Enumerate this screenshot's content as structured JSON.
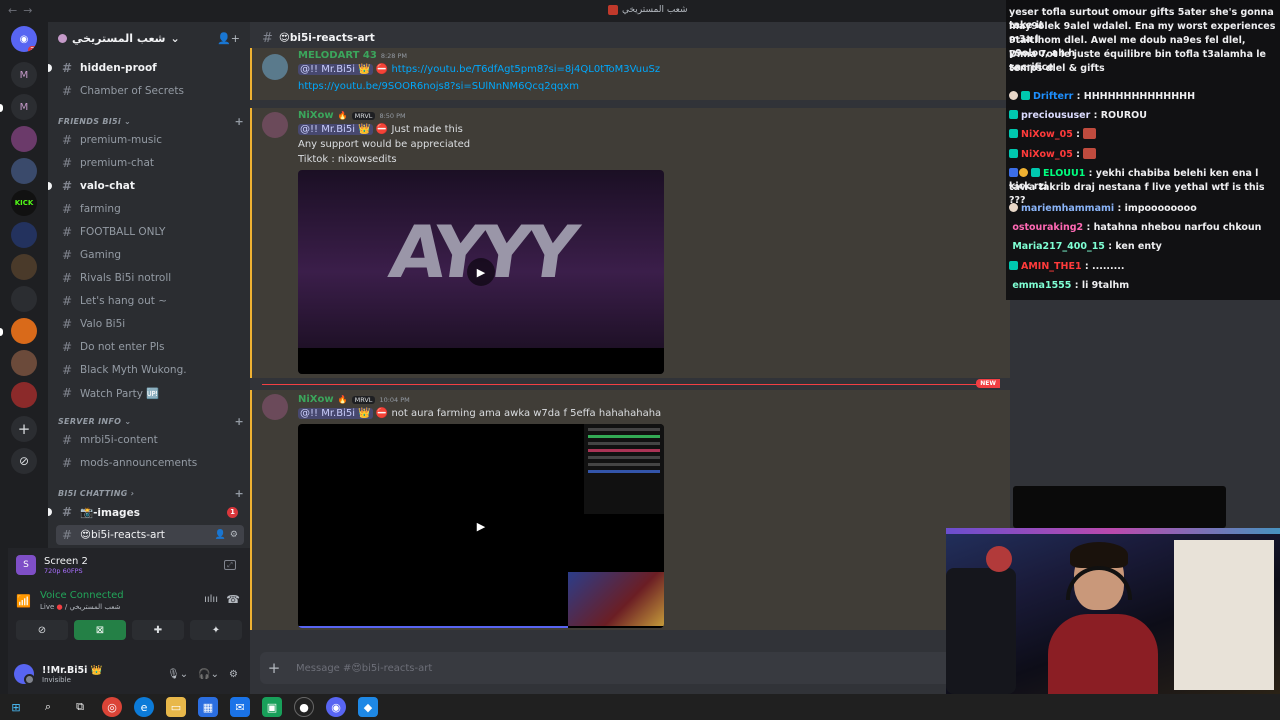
{
  "window": {
    "title": "شعب المستريخي"
  },
  "rail": {
    "badge_count": "33",
    "kick_label": "KICK",
    "dm_badge": "1"
  },
  "sidebar": {
    "guild_name": "شعب المستريخي",
    "channels_top": [
      {
        "name": "hidden-proof"
      },
      {
        "name": "Chamber of Secrets"
      }
    ],
    "category_friends": "FRIENDS BI5i",
    "channels_friends": [
      {
        "name": "premium-music"
      },
      {
        "name": "premium-chat"
      },
      {
        "name": "valo-chat"
      },
      {
        "name": "farming"
      },
      {
        "name": "FOOTBALL ONLY"
      },
      {
        "name": "Gaming"
      },
      {
        "name": "Rivals Bi5i notroll"
      },
      {
        "name": "Let's hang out ~"
      },
      {
        "name": "Valo Bi5i"
      },
      {
        "name": "Do not enter Pls"
      },
      {
        "name": "Black Myth Wukong."
      },
      {
        "name": "Watch Party 🆙"
      }
    ],
    "category_server": "SERVER INFO",
    "channels_server": [
      {
        "name": "mrbi5i-content"
      },
      {
        "name": "mods-announcements"
      }
    ],
    "category_chatting": "BI5I CHATTING",
    "channels_chatting": [
      {
        "name": "📸-images",
        "badge": "1"
      },
      {
        "name": "😍bi5i-reacts-art"
      }
    ]
  },
  "voice": {
    "screen_title": "Screen 2",
    "screen_sub": "720p 60FPS",
    "status": "Voice Connected",
    "live_label": "Live",
    "server": "شعب المستريخي"
  },
  "user": {
    "name": "!!Mr.Bi5i 👑",
    "status": "Invisible"
  },
  "channel": {
    "name": "😍bi5i-reacts-art",
    "composer_placeholder": "Message #😍bi5i-reacts-art"
  },
  "messages": [
    {
      "author": "MELODART 43",
      "time": "8:28 PM",
      "mention": "@!! Mr.Bi5i 👑",
      "link1": "https://youtu.be/T6dfAgt5pm8?si=8j4QL0tToM3VuuSz",
      "link2": "https://youtu.be/9SOOR6nojs8?si=SUlNnNM6Qcq2qqxm"
    },
    {
      "author": "NiXow",
      "tag": "MRVL",
      "time": "8:50 PM",
      "mention": "@!! Mr.Bi5i 👑",
      "line1": "Just made this",
      "line2": "Any support would be appreciated",
      "line3": "Tiktok : nixowsedits",
      "video_text": "AYYY"
    },
    {
      "author": "NiXow",
      "tag": "MRVL",
      "time": "10:04 PM",
      "mention": "@!! Mr.Bi5i 👑",
      "line1": "not aura farming ama awka w7da f 5effa hahahahaha"
    }
  ],
  "new_label": "NEW",
  "stream_chat": [
    {
      "user": "",
      "text": "yeser tofla surtout omour gifts 5ater she's gonna take it"
    },
    {
      "user": "",
      "text": "may9olek 9alel wdalel. Ena my worst experiences m3a l"
    },
    {
      "user": "",
      "text": "9taltlhom dlel. Awel me doub na9es fel dlel, y9olou, ah h"
    },
    {
      "user": "",
      "text": "Dima 7ot le juste équilibre bin tofla t3alamha le sacrifice"
    },
    {
      "user": "",
      "text": "temps dlel & gifts"
    },
    {
      "user": "Drifterr",
      "text": "HHHHHHHHHHHHHH"
    },
    {
      "user": "precioususer",
      "text": "ROUROU"
    },
    {
      "user": "NiXow_05",
      "text": ""
    },
    {
      "user": "NiXow_05",
      "text": ""
    },
    {
      "user": "ELOUU1",
      "text": "yekhi chabiba belehi ken ena l kick rzi"
    },
    {
      "user": "",
      "text": "tawa takrib draj nestana f live yethal wtf is this ???"
    },
    {
      "user": "mariemhammami",
      "text": "impoooooooo"
    },
    {
      "user": "ostouraking2",
      "text": "hatahna nhebou narfou chkoun"
    },
    {
      "user": "Maria217_400_15",
      "text": "ken enty"
    },
    {
      "user": "AMIN_THE1",
      "text": "........."
    },
    {
      "user": "emma1555",
      "text": "li 9talhm"
    }
  ],
  "colors": {
    "accent": "#5865f2",
    "mention_bg": "#3c4270",
    "link": "#00a8fc",
    "voice_green": "#23a55a",
    "new_red": "#f23f43",
    "nixow_green": "#3ba55c",
    "melod_green": "#3ba55c"
  }
}
